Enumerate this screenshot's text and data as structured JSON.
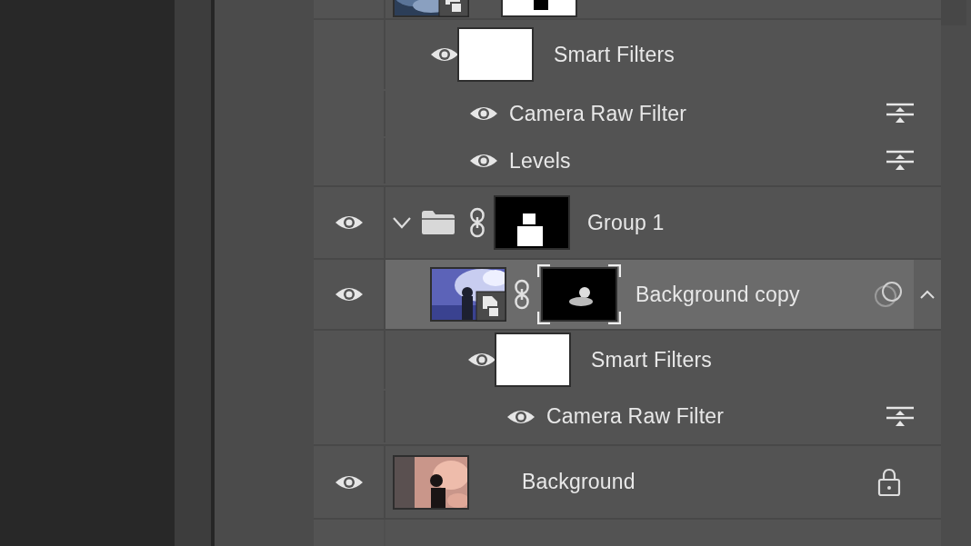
{
  "layers": [
    {
      "kind": "smart-object",
      "selected": false,
      "mask": true,
      "smart_filters": {
        "label": "Smart Filters",
        "visible": true,
        "filters": [
          {
            "name": "Camera Raw Filter",
            "visible": true
          },
          {
            "name": "Levels",
            "visible": true
          }
        ]
      }
    },
    {
      "kind": "group",
      "name": "Group 1",
      "visible": true,
      "selected": false,
      "expanded": true,
      "linked": true,
      "mask": true,
      "children": [
        {
          "kind": "smart-object",
          "name": "Background copy",
          "visible": true,
          "selected": true,
          "linked": true,
          "mask": true,
          "mask_selected": true,
          "filters_expanded": true,
          "smart_filters": {
            "label": "Smart Filters",
            "visible": true,
            "filters": [
              {
                "name": "Camera Raw Filter",
                "visible": true
              }
            ]
          }
        }
      ]
    },
    {
      "kind": "layer",
      "name": "Background",
      "visible": true,
      "selected": false,
      "locked": true
    }
  ]
}
